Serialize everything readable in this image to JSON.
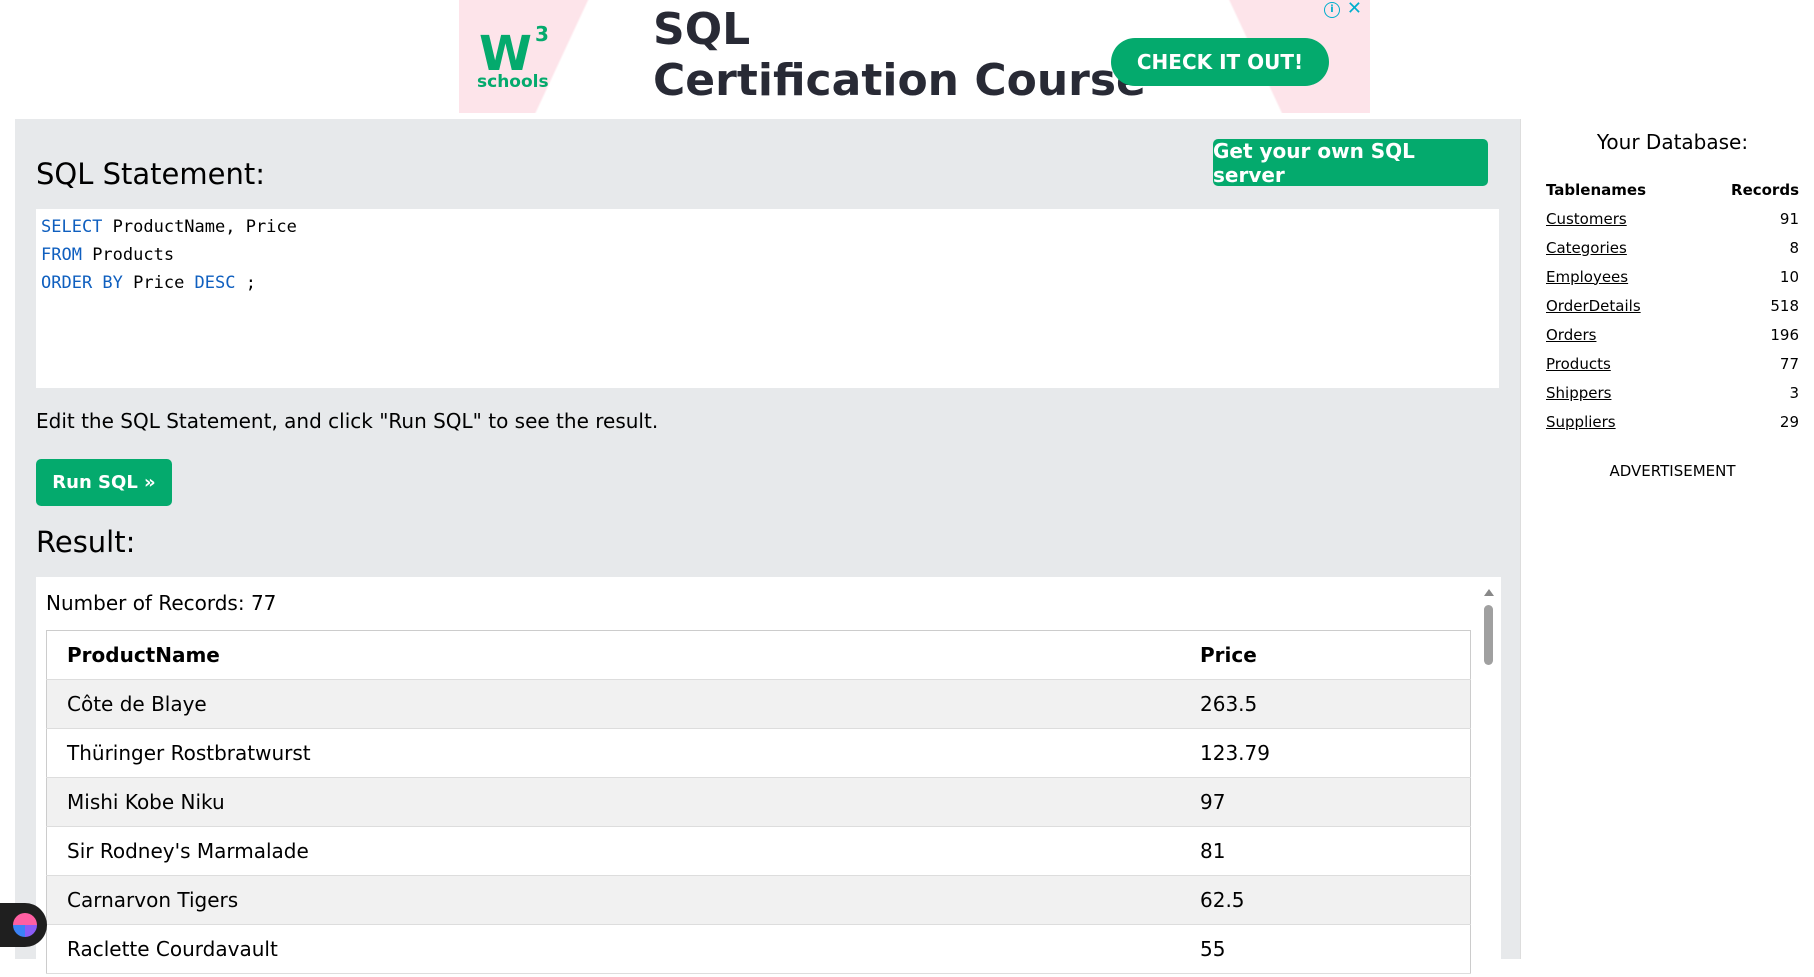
{
  "ad": {
    "logo_text": "W",
    "logo_sup": "3",
    "logo_sub": "schools",
    "title_line1": "SQL",
    "title_line2": "Certification Course",
    "cta": "CHECK IT OUT!",
    "info": "i",
    "close": "✕"
  },
  "main": {
    "heading": "SQL Statement:",
    "own_server_button": "Get your own SQL server",
    "query": {
      "line1_kw": "SELECT",
      "line1_rest": " ProductName, Price",
      "line2_kw": "FROM",
      "line2_rest": " Products",
      "line3_kw1": "ORDER BY",
      "line3_mid": " Price ",
      "line3_kw2": "DESC",
      "line3_end": " ;"
    },
    "instructions": "Edit the SQL Statement, and click \"Run SQL\" to see the result.",
    "run_button": "Run SQL »",
    "result_heading": "Result:"
  },
  "result": {
    "records_label": "Number of Records: 77",
    "columns": [
      "ProductName",
      "Price"
    ],
    "rows": [
      [
        "Côte de Blaye",
        "263.5"
      ],
      [
        "Thüringer Rostbratwurst",
        "123.79"
      ],
      [
        "Mishi Kobe Niku",
        "97"
      ],
      [
        "Sir Rodney's Marmalade",
        "81"
      ],
      [
        "Carnarvon Tigers",
        "62.5"
      ],
      [
        "Raclette Courdavault",
        "55"
      ]
    ]
  },
  "sidebar": {
    "title": "Your Database:",
    "col_tablenames": "Tablenames",
    "col_records": "Records",
    "tables": [
      {
        "name": "Customers",
        "records": "91"
      },
      {
        "name": "Categories",
        "records": "8"
      },
      {
        "name": "Employees",
        "records": "10"
      },
      {
        "name": "OrderDetails",
        "records": "518"
      },
      {
        "name": "Orders",
        "records": "196"
      },
      {
        "name": "Products",
        "records": "77"
      },
      {
        "name": "Shippers",
        "records": "3"
      },
      {
        "name": "Suppliers",
        "records": "29"
      }
    ],
    "advertisement": "ADVERTISEMENT"
  },
  "colors": {
    "accent": "#04aa6d",
    "panel": "#e7e9eb",
    "keyword": "#0f5fbf"
  }
}
